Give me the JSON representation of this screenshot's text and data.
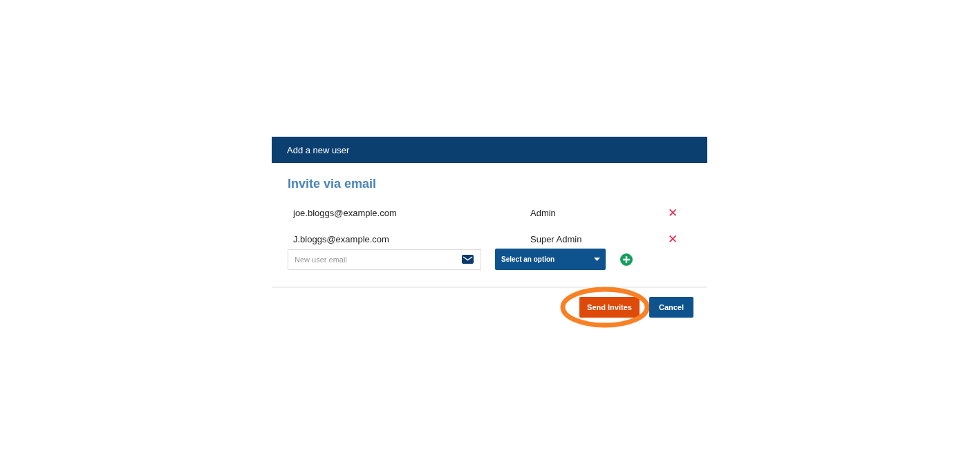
{
  "dialog": {
    "title": "Add a new user"
  },
  "section_title": "Invite via email",
  "invites": [
    {
      "email": "joe.bloggs@example.com",
      "role": "Admin",
      "remove": "✕"
    },
    {
      "email": "J.bloggs@example.com",
      "role": "Super Admin",
      "remove": "✕"
    }
  ],
  "new_invite": {
    "email_placeholder": "New user email",
    "role_select": "Select an option"
  },
  "buttons": [
    {
      "label": "Send Invites",
      "kind": "primary",
      "highlighted": true
    },
    {
      "label": "Cancel",
      "kind": "secondary",
      "highlighted": false
    }
  ]
}
